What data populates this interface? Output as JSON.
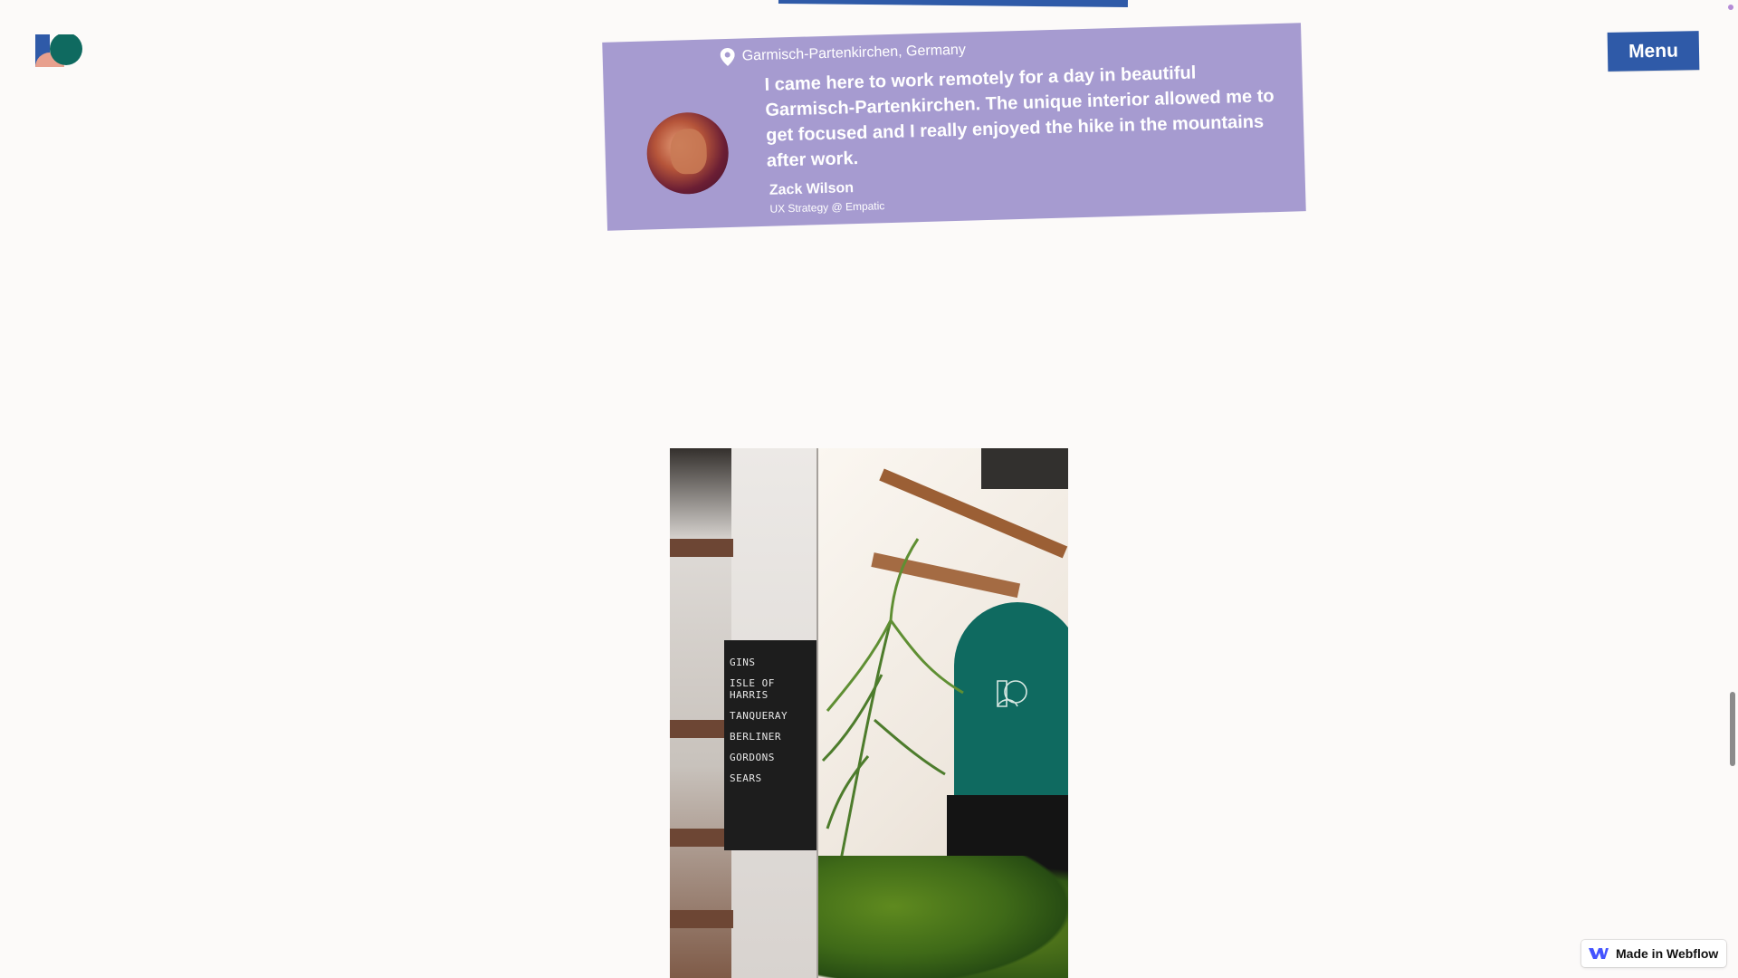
{
  "header": {
    "menu_label": "Menu"
  },
  "testimonial": {
    "location": "Garmisch-Partenkirchen, Germany",
    "quote": "I came here to work remotely for a day in beautiful Garmisch-Partenkirchen. The unique interior allowed me to get focused and I really enjoyed the hike in the mountains after work.",
    "author_name": "Zack Wilson",
    "author_role": "UX Strategy @ Empatic"
  },
  "photo": {
    "chalkboard_lines": [
      "GINS",
      "ISLE OF HARRIS",
      "TANQUERAY",
      "BERLINER",
      "GORDONS",
      "SEARS"
    ]
  },
  "badge": {
    "label": "Made in Webflow"
  },
  "colors": {
    "accent_blue": "#2f5aa8",
    "card_lavender": "#a69bd0",
    "teal": "#0f6a60"
  }
}
